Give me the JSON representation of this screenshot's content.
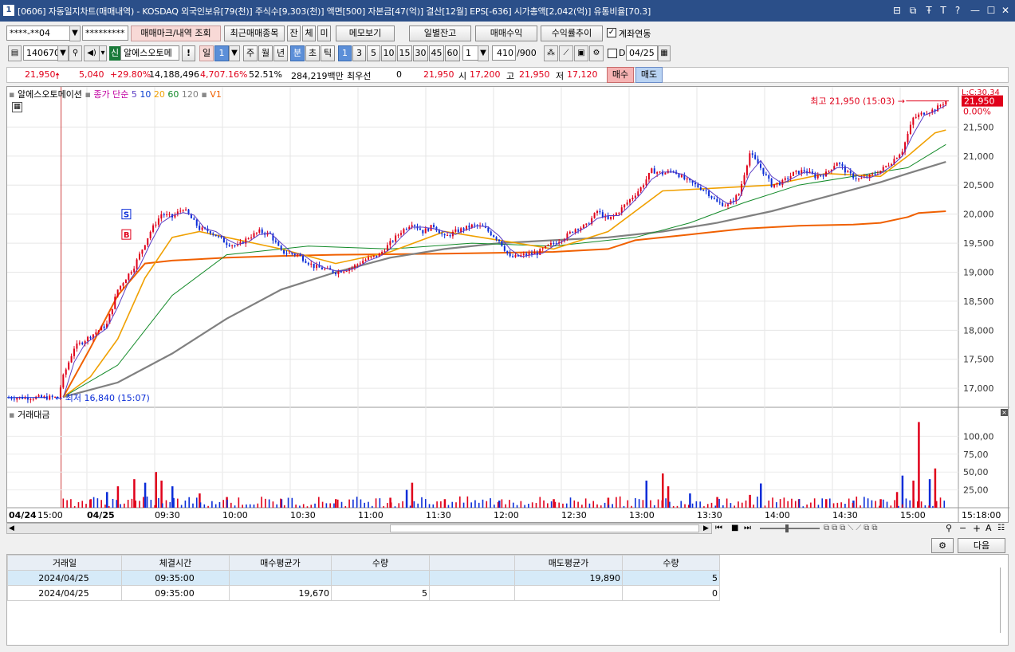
{
  "titlebar": {
    "badge": "1",
    "title": "[0606] 자동일지차트(매매내역) - KOSDAQ 외국인보유[79(천)] 주식수[9,303(천)] 액면[500] 자본금[47(억)] 결산[12월] EPS[-636] 시가총액[2,042(억)] 유통비율[70.3]",
    "controls": [
      "⊟",
      "⧉",
      "Ŧ",
      "T",
      "?",
      "—",
      "☐",
      "✕"
    ]
  },
  "toolbar1": {
    "account": "****-**04",
    "password": "*********",
    "btn_marks": "매매마크/내역 조회",
    "btn_recent": "최근매매종목",
    "btn_jan": "잔",
    "btn_che": "체",
    "btn_mi": "미",
    "btn_memo": "메모보기",
    "btn_daily_balance": "일별잔고",
    "btn_trade_profit": "매매수익",
    "btn_return_trend": "수익률추이",
    "account_link_label": "계좌연동",
    "account_link_checked": true
  },
  "toolbar2": {
    "code": "140670",
    "badge_new": "신",
    "name": "알에스오토메",
    "btn_excl": "!",
    "period_day": "일",
    "period_count": "1",
    "btn_week": "주",
    "btn_month": "월",
    "btn_year": "년",
    "btn_min": "분",
    "btn_sec": "초",
    "btn_tick": "틱",
    "minute_options": [
      "1",
      "3",
      "5",
      "10",
      "15",
      "30",
      "45",
      "60"
    ],
    "minute_selected": "1",
    "custom_min": "1",
    "count": "410",
    "total": "/900",
    "d_label": "D",
    "date": "04/25"
  },
  "quote": {
    "price": "21,950",
    "change": "5,040",
    "pct": "+29.80%",
    "volume": "14,188,496",
    "vol_pct": "4,707.16%",
    "turnover": "52.51%",
    "amount": "284,219백만",
    "best_label": "최우선",
    "best_qty": "0",
    "best_price": "21,950",
    "open_label": "시",
    "open": "17,200",
    "high_label": "고",
    "high": "21,950",
    "low_label": "저",
    "low": "17,120",
    "btn_buy": "매수",
    "btn_sell": "매도"
  },
  "chart_legend": {
    "name": "알에스오토메이션",
    "ma_label": "종가 단순",
    "ma_periods": [
      "5",
      "10",
      "20",
      "60",
      "120"
    ],
    "v1": "V1"
  },
  "chart_annotations": {
    "high_note": "최고 21,950 (15:03)",
    "low_note": "최저 16,840 (15:07)",
    "marker_s": "S",
    "marker_b": "B",
    "price_tag": "21,950",
    "pct_tag": "0.00%",
    "limit_tag": "L:C:30.34"
  },
  "volume_panel": {
    "title": "거래대금",
    "y_ticks": [
      "100,00",
      "75,00",
      "50,00",
      "25,00"
    ]
  },
  "colors": {
    "up": "#e0001a",
    "down": "#0b2dd8",
    "ma5": "#5b3cc4",
    "ma10": "#0f7a1f",
    "ma20": "#f0a000",
    "ma60": "#128a28",
    "ma120": "#808080",
    "ma_long": "#f06000",
    "title_bar": "#2b4f89"
  },
  "chart_data": {
    "type": "candlestick",
    "x_ticks": [
      "04/24",
      "15:00",
      "04/25",
      "09:30",
      "10:00",
      "10:30",
      "11:00",
      "11:30",
      "12:00",
      "12:30",
      "13:00",
      "13:30",
      "14:00",
      "14:30",
      "15:00",
      "15:18:00"
    ],
    "y_ticks": [
      21500,
      21000,
      20500,
      20000,
      19500,
      19000,
      18500,
      18000,
      17500,
      17000
    ],
    "ylim": [
      16700,
      22000
    ],
    "price_path": [
      [
        0,
        16840
      ],
      [
        3,
        16840
      ],
      [
        5,
        16840
      ],
      [
        7,
        16840
      ],
      [
        9,
        16840
      ],
      [
        10,
        17200
      ],
      [
        12,
        17700
      ],
      [
        15,
        17900
      ],
      [
        18,
        18100
      ],
      [
        20,
        18700
      ],
      [
        23,
        19100
      ],
      [
        26,
        19700
      ],
      [
        28,
        20000
      ],
      [
        30,
        19950
      ],
      [
        32,
        20100
      ],
      [
        35,
        19750
      ],
      [
        37,
        19700
      ],
      [
        40,
        19500
      ],
      [
        42,
        19450
      ],
      [
        44,
        19600
      ],
      [
        46,
        19700
      ],
      [
        48,
        19650
      ],
      [
        50,
        19350
      ],
      [
        53,
        19300
      ],
      [
        56,
        19100
      ],
      [
        58,
        19050
      ],
      [
        60,
        19000
      ],
      [
        63,
        19080
      ],
      [
        65,
        19200
      ],
      [
        68,
        19300
      ],
      [
        70,
        19500
      ],
      [
        72,
        19700
      ],
      [
        74,
        19850
      ],
      [
        76,
        19700
      ],
      [
        78,
        19800
      ],
      [
        80,
        19600
      ],
      [
        82,
        19700
      ],
      [
        85,
        19800
      ],
      [
        87,
        19780
      ],
      [
        90,
        19550
      ],
      [
        92,
        19250
      ],
      [
        95,
        19300
      ],
      [
        97,
        19330
      ],
      [
        99,
        19450
      ],
      [
        102,
        19600
      ],
      [
        104,
        19750
      ],
      [
        106,
        19800
      ],
      [
        108,
        20050
      ],
      [
        110,
        19900
      ],
      [
        112,
        20050
      ],
      [
        114,
        20250
      ],
      [
        116,
        20450
      ],
      [
        118,
        20750
      ],
      [
        120,
        20700
      ],
      [
        122,
        20750
      ],
      [
        124,
        20600
      ],
      [
        126,
        20500
      ],
      [
        128,
        20400
      ],
      [
        130,
        20200
      ],
      [
        132,
        20150
      ],
      [
        134,
        20350
      ],
      [
        136,
        21050
      ],
      [
        138,
        20800
      ],
      [
        140,
        20500
      ],
      [
        142,
        20550
      ],
      [
        144,
        20700
      ],
      [
        146,
        20750
      ],
      [
        148,
        20650
      ],
      [
        150,
        20700
      ],
      [
        152,
        20900
      ],
      [
        154,
        20700
      ],
      [
        156,
        20600
      ],
      [
        158,
        20650
      ],
      [
        160,
        20750
      ],
      [
        162,
        20900
      ],
      [
        164,
        21100
      ],
      [
        166,
        21650
      ],
      [
        168,
        21750
      ],
      [
        170,
        21800
      ],
      [
        172,
        21950
      ]
    ],
    "ma_paths": {
      "ma20": [
        [
          10,
          16850
        ],
        [
          15,
          17200
        ],
        [
          20,
          17850
        ],
        [
          25,
          18900
        ],
        [
          30,
          19600
        ],
        [
          35,
          19700
        ],
        [
          40,
          19600
        ],
        [
          50,
          19400
        ],
        [
          60,
          19150
        ],
        [
          70,
          19350
        ],
        [
          80,
          19700
        ],
        [
          90,
          19550
        ],
        [
          100,
          19400
        ],
        [
          110,
          19700
        ],
        [
          120,
          20400
        ],
        [
          130,
          20450
        ],
        [
          140,
          20500
        ],
        [
          150,
          20700
        ],
        [
          160,
          20650
        ],
        [
          165,
          21000
        ],
        [
          170,
          21400
        ],
        [
          172,
          21450
        ]
      ],
      "ma60": [
        [
          10,
          16850
        ],
        [
          20,
          17400
        ],
        [
          30,
          18600
        ],
        [
          40,
          19300
        ],
        [
          55,
          19450
        ],
        [
          70,
          19400
        ],
        [
          85,
          19500
        ],
        [
          100,
          19450
        ],
        [
          115,
          19600
        ],
        [
          125,
          19850
        ],
        [
          135,
          20200
        ],
        [
          145,
          20500
        ],
        [
          155,
          20650
        ],
        [
          165,
          20800
        ],
        [
          172,
          21200
        ]
      ],
      "ma120": [
        [
          10,
          16850
        ],
        [
          20,
          17100
        ],
        [
          30,
          17600
        ],
        [
          40,
          18200
        ],
        [
          50,
          18700
        ],
        [
          60,
          19000
        ],
        [
          70,
          19250
        ],
        [
          80,
          19400
        ],
        [
          90,
          19500
        ],
        [
          100,
          19550
        ],
        [
          110,
          19600
        ],
        [
          120,
          19700
        ],
        [
          130,
          19850
        ],
        [
          140,
          20050
        ],
        [
          150,
          20300
        ],
        [
          160,
          20550
        ],
        [
          165,
          20700
        ],
        [
          172,
          20900
        ]
      ],
      "ma_long": [
        [
          10,
          16850
        ],
        [
          15,
          17700
        ],
        [
          20,
          18600
        ],
        [
          25,
          19150
        ],
        [
          30,
          19200
        ],
        [
          40,
          19250
        ],
        [
          50,
          19280
        ],
        [
          60,
          19300
        ],
        [
          80,
          19320
        ],
        [
          100,
          19350
        ],
        [
          110,
          19400
        ],
        [
          115,
          19550
        ],
        [
          125,
          19650
        ],
        [
          135,
          19750
        ],
        [
          145,
          19800
        ],
        [
          155,
          19820
        ],
        [
          160,
          19850
        ],
        [
          165,
          19950
        ],
        [
          167,
          20020
        ],
        [
          172,
          20050
        ]
      ]
    },
    "volume": {
      "ylim": [
        0,
        125
      ],
      "bars": [
        [
          15,
          12
        ],
        [
          18,
          22
        ],
        [
          20,
          30
        ],
        [
          23,
          40
        ],
        [
          25,
          35
        ],
        [
          27,
          50
        ],
        [
          28,
          38
        ],
        [
          30,
          30
        ],
        [
          35,
          20
        ],
        [
          40,
          15
        ],
        [
          50,
          12
        ],
        [
          60,
          12
        ],
        [
          70,
          14
        ],
        [
          73,
          25
        ],
        [
          74,
          35
        ],
        [
          80,
          12
        ],
        [
          90,
          10
        ],
        [
          100,
          12
        ],
        [
          110,
          14
        ],
        [
          117,
          38
        ],
        [
          120,
          48
        ],
        [
          121,
          30
        ],
        [
          125,
          20
        ],
        [
          130,
          15
        ],
        [
          136,
          18
        ],
        [
          138,
          34
        ],
        [
          145,
          12
        ],
        [
          150,
          12
        ],
        [
          155,
          10
        ],
        [
          160,
          12
        ],
        [
          163,
          22
        ],
        [
          164,
          45
        ],
        [
          166,
          38
        ],
        [
          167,
          120
        ],
        [
          169,
          40
        ],
        [
          170,
          55
        ]
      ]
    }
  },
  "chart_nav": {
    "prev": "◀",
    "play": "▶",
    "first": "⏮",
    "stop": "■",
    "last": "⏭",
    "zoom_in": "+",
    "zoom_out": "−",
    "font_a": "A"
  },
  "bottom": {
    "btn_next": "다음",
    "columns": [
      "거래일",
      "체결시간",
      "매수평균가",
      "수량",
      "",
      "매도평균가",
      "수량"
    ],
    "rows": [
      [
        "2024/04/25",
        "09:35:00",
        "",
        "",
        "",
        "19,890",
        "5"
      ],
      [
        "2024/04/25",
        "09:35:00",
        "19,670",
        "5",
        "",
        "",
        "0"
      ]
    ]
  }
}
